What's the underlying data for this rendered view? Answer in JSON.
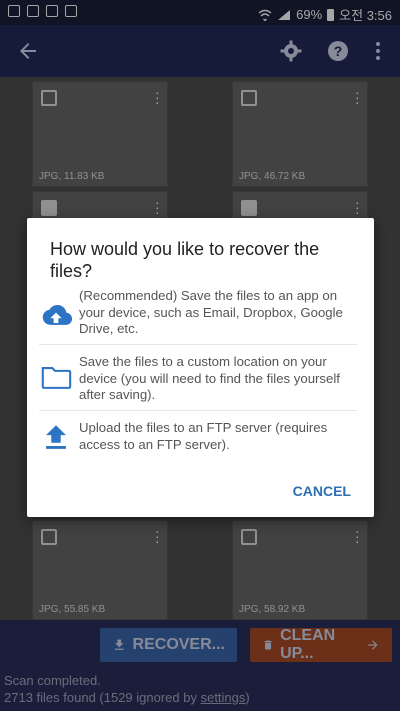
{
  "status_bar": {
    "battery": "69%",
    "time": "오전 3:56"
  },
  "toolbar": {
    "back_icon": "arrow-back-icon",
    "settings_icon": "gear-icon",
    "help_icon": "help-icon",
    "more_icon": "more-vert-icon"
  },
  "thumbnails": [
    {
      "meta": "JPG, 11.83 KB",
      "checked": false
    },
    {
      "meta": "JPG, 46.72 KB",
      "checked": false
    },
    {
      "meta": "",
      "checked": true
    },
    {
      "meta": "",
      "checked": true
    },
    {
      "meta": "JPG, 55.85 KB",
      "checked": false
    },
    {
      "meta": "JPG, 58.92 KB",
      "checked": false
    }
  ],
  "dialog": {
    "title": "How would you like to recover the files?",
    "options": [
      {
        "icon": "cloud-upload-icon",
        "text": "(Recommended) Save the files to an app on your device, such as Email, Dropbox, Google Drive, etc."
      },
      {
        "icon": "folder-icon",
        "text": "Save the files to a custom location on your device (you will need to find the files yourself after saving)."
      },
      {
        "icon": "upload-icon",
        "text": "Upload the files to an FTP server (requires access to an FTP server)."
      }
    ],
    "cancel_label": "CANCEL"
  },
  "bottom": {
    "recover_label": "RECOVER...",
    "clean_label": "CLEAN UP...",
    "scan_status": "Scan completed.",
    "files_found_prefix": "2713 files found (1529 ignored by ",
    "files_found_link": "settings",
    "files_found_suffix": ")"
  },
  "colors": {
    "appbar": "#232a5a",
    "accent": "#2e6fb3",
    "recover_button": "#3a64a9",
    "clean_button": "#a54a24"
  }
}
